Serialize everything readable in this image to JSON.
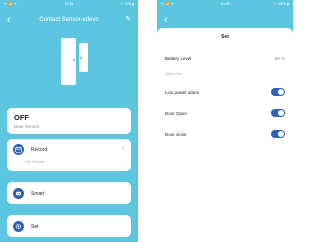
{
  "left_screen": {
    "status_bar": {
      "carrier": "ᯤ 📶 ᯤ",
      "time": "10:15",
      "battery": "⚡ 71% ▮"
    },
    "nav": {
      "back_glyph": "‹",
      "title": "Contact Sensor-vdevo",
      "edit_glyph": "✎"
    },
    "device_state": {
      "state": "OFF",
      "device_type": "Door Sensor"
    },
    "menu": [
      {
        "label": "Record",
        "icon": "calendar-icon",
        "subtext": "+ No Record",
        "chevron": "›"
      },
      {
        "label": "Smart",
        "icon": "smart-scene-icon"
      },
      {
        "label": "Set",
        "icon": "settings-gear-icon"
      }
    ]
  },
  "right_screen": {
    "status_bar": {
      "carrier": "ᯤ 📶 ᯤ",
      "time": "10:25",
      "battery": "⚡ 100% ▮"
    },
    "nav": {
      "back_glyph": "‹"
    },
    "settings": {
      "title": "Set",
      "battery_label": "Battery Level",
      "battery_value": "66 %",
      "section_label": "Alarm Set",
      "toggles": [
        {
          "label": "Low power alarm",
          "on": true
        },
        {
          "label": "Door Open",
          "on": true
        },
        {
          "label": "Door close",
          "on": true
        }
      ]
    }
  },
  "colors": {
    "accent": "#2c63b5",
    "background": "#5cc5e0",
    "card": "#ffffff",
    "record_chevron": "#e05a4e"
  }
}
